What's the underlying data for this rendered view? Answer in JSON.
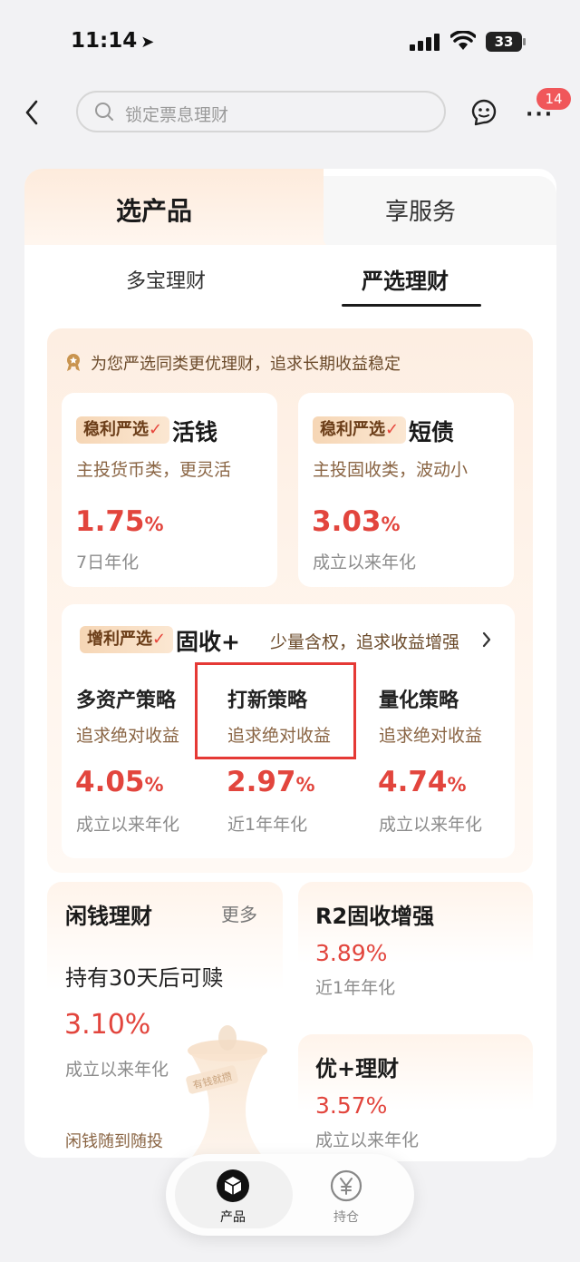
{
  "status_bar": {
    "time": "11:14",
    "battery": "33"
  },
  "nav": {
    "search_placeholder": "锁定票息理财",
    "badge_count": "14"
  },
  "tabs": {
    "main": [
      "选产品",
      "享服务"
    ],
    "sub": [
      "多宝理财",
      "严选理财"
    ]
  },
  "banner": "为您严选同类更优理财，追求长期收益稳定",
  "top_cards": [
    {
      "tag": "稳利严选",
      "title": "活钱",
      "subtitle": "主投货币类，更灵活",
      "rate": "1.75",
      "unit": "%",
      "rate_label": "7日年化"
    },
    {
      "tag": "稳利严选",
      "title": "短债",
      "subtitle": "主投固收类，波动小",
      "rate": "3.03",
      "unit": "%",
      "rate_label": "成立以来年化"
    }
  ],
  "fixed_card": {
    "tag": "增利严选",
    "title": "固收+",
    "desc": "少量含权，追求收益增强",
    "strategies": [
      {
        "title": "多资产策略",
        "subtitle": "追求绝对收益",
        "rate": "4.05",
        "unit": "%",
        "rate_label": "成立以来年化"
      },
      {
        "title": "打新策略",
        "subtitle": "追求绝对收益",
        "rate": "2.97",
        "unit": "%",
        "rate_label": "近1年年化"
      },
      {
        "title": "量化策略",
        "subtitle": "追求绝对收益",
        "rate": "4.74",
        "unit": "%",
        "rate_label": "成立以来年化"
      }
    ]
  },
  "idle_money": {
    "title": "闲钱理财",
    "more": "更多",
    "subtitle": "持有30天后可赎",
    "rate": "3.10%",
    "rate_label": "成立以来年化",
    "footer": "闲钱随到随投",
    "hourglass_text": "有钱就攒"
  },
  "r2_card": {
    "title": "R2固收增强",
    "rate": "3.89%",
    "rate_label": "近1年年化"
  },
  "plus_card": {
    "title": "优+理财",
    "rate": "3.57%",
    "rate_label": "成立以来年化"
  },
  "bottom_nav": [
    "产品",
    "持仓"
  ],
  "colors": {
    "accent_red": "#e2453d",
    "badge_red": "#f0575a",
    "highlight_box": "#e53935"
  }
}
